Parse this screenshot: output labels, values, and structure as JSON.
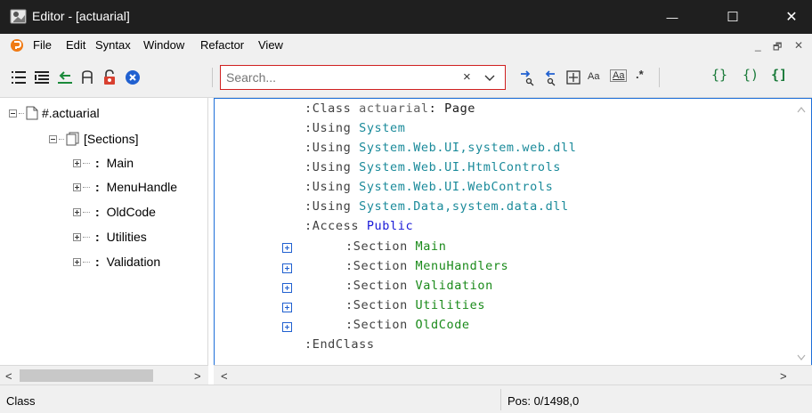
{
  "window": {
    "title": "Editor - [actuarial]",
    "icon": "editor-app-icon",
    "minimize_glyph": "—",
    "maximize_glyph": "☐",
    "close_glyph": "✕"
  },
  "menu": {
    "items": [
      "File",
      "Edit",
      "Syntax",
      "Window",
      "Refactor",
      "View"
    ],
    "mdi_minimize": "_",
    "mdi_restore": "🗗",
    "mdi_close": "✕"
  },
  "toolbar": {
    "search_placeholder": "Search...",
    "search_clear": "×",
    "icons_left": [
      "outline-list-icon",
      "indent-list-icon",
      "back-arrow-icon",
      "font-icon",
      "lock-off-icon",
      "close-circle-icon"
    ],
    "icons_right": [
      "find-next-icon",
      "find-prev-icon",
      "select-all-icon",
      "match-case-icon",
      "whole-word-icon",
      "regex-icon",
      "braces-icon",
      "brace-paren-icon",
      "brace-bracket-icon"
    ],
    "match_case_label": "Aa",
    "whole_word_label": "Aa",
    "regex_label": ".*"
  },
  "tree": {
    "root": "#.actuarial",
    "sections": "[Sections]",
    "items": [
      "Main",
      "MenuHandle",
      "OldCode",
      "Utilities",
      "Validation"
    ]
  },
  "code": {
    "lines": [
      {
        "kw": ":Class",
        "a": " actuarial",
        "b": ": Page"
      },
      {
        "kw": ":Using",
        "a": " System",
        "b": ""
      },
      {
        "kw": ":Using",
        "a": " System.Web.UI,system.web.dll",
        "b": ""
      },
      {
        "kw": ":Using",
        "a": " System.Web.UI.HtmlControls",
        "b": ""
      },
      {
        "kw": ":Using",
        "a": " System.Web.UI.WebControls",
        "b": ""
      },
      {
        "kw": ":Using",
        "a": " System.Data,system.data.dll",
        "b": ""
      },
      {
        "kw": ":Access",
        "a": " Public",
        "b": ""
      },
      {
        "kw": ":Section",
        "a": " Main",
        "b": ""
      },
      {
        "kw": ":Section",
        "a": " MenuHandlers",
        "b": ""
      },
      {
        "kw": ":Section",
        "a": " Validation",
        "b": ""
      },
      {
        "kw": ":Section",
        "a": " Utilities",
        "b": ""
      },
      {
        "kw": ":Section",
        "a": " OldCode",
        "b": ""
      },
      {
        "kw": ":EndClass",
        "a": "",
        "b": ""
      }
    ]
  },
  "scroll": {
    "left_arrow": "<",
    "right_arrow": ">"
  },
  "status": {
    "left": "Class",
    "position": "Pos: 0/1498,0"
  },
  "colors": {
    "accent_border": "#1e6fd9",
    "search_border": "#d02020",
    "fold_box": "#2060d0"
  }
}
